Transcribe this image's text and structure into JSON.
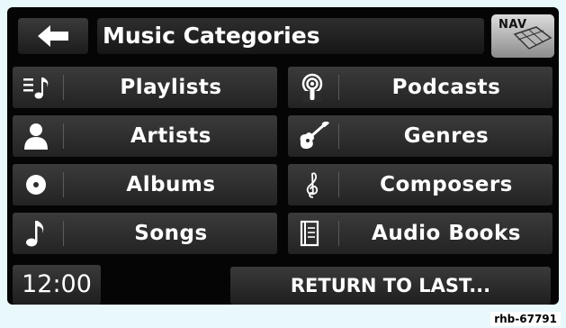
{
  "header": {
    "title": "Music Categories",
    "back_icon": "back-arrow-icon",
    "nav_label": "NAV"
  },
  "categories": [
    {
      "label": "Playlists",
      "icon": "playlist-icon"
    },
    {
      "label": "Podcasts",
      "icon": "podcast-icon"
    },
    {
      "label": "Artists",
      "icon": "artist-icon"
    },
    {
      "label": "Genres",
      "icon": "guitar-icon"
    },
    {
      "label": "Albums",
      "icon": "disc-icon"
    },
    {
      "label": "Composers",
      "icon": "treble-clef-icon"
    },
    {
      "label": "Songs",
      "icon": "music-note-icon"
    },
    {
      "label": "Audio Books",
      "icon": "book-icon"
    }
  ],
  "footer": {
    "time": "12:00",
    "return_label": "RETURN TO LAST..."
  },
  "image_code": "rhb-67791"
}
